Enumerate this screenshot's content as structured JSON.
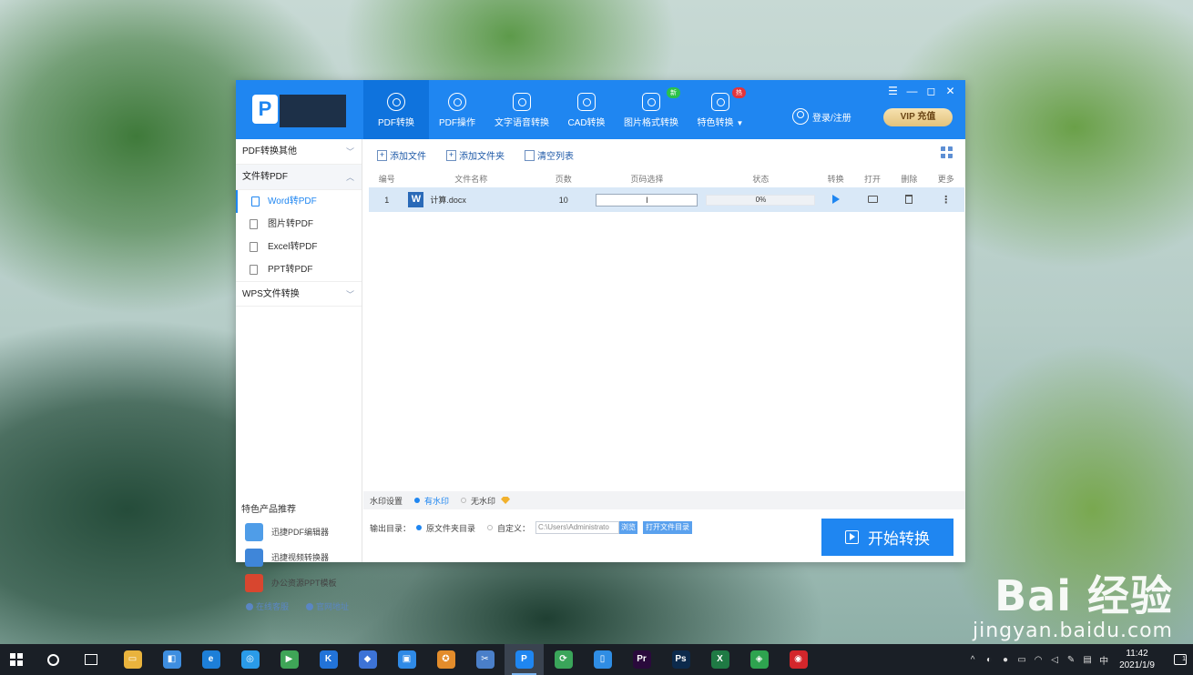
{
  "app": {
    "logo_letter": "P",
    "nav": [
      {
        "label": "PDF转换"
      },
      {
        "label": "PDF操作"
      },
      {
        "label": "文字语音转换"
      },
      {
        "label": "CAD转换"
      },
      {
        "label": "图片格式转换",
        "badge": "新"
      },
      {
        "label": "特色转换",
        "badge": "热"
      }
    ],
    "login_label": "登录/注册",
    "vip_label": "VIP 充值",
    "window_controls": {
      "menu": "☰",
      "minimize": "—",
      "maximize": "◻",
      "close": "✕"
    }
  },
  "sidebar": {
    "sections": [
      {
        "label": "PDF转换其他",
        "chevron": "﹀"
      },
      {
        "label": "文件转PDF",
        "chevron": "︿"
      },
      {
        "label": "WPS文件转换",
        "chevron": "﹀"
      }
    ],
    "items": [
      {
        "label": "Word转PDF"
      },
      {
        "label": "图片转PDF"
      },
      {
        "label": "Excel转PDF"
      },
      {
        "label": "PPT转PDF"
      }
    ],
    "promo_title": "特色产品推荐",
    "promos": [
      {
        "label": "迅捷PDF编辑器",
        "color": "#4f9de8"
      },
      {
        "label": "迅捷视频转换器",
        "color": "#3f86d9"
      },
      {
        "label": "办公资源PPT模板",
        "color": "#d8462f"
      }
    ],
    "footer": {
      "service": "在线客服",
      "website": "官网地址"
    }
  },
  "toolbar": {
    "add_file": "添加文件",
    "add_folder": "添加文件夹",
    "clear_list": "清空列表"
  },
  "table": {
    "headers": [
      "编号",
      "文件名称",
      "页数",
      "页码选择",
      "状态",
      "转换",
      "打开",
      "删除",
      "更多"
    ],
    "rows": [
      {
        "num": "1",
        "name": "计算.docx",
        "pages": "10",
        "range": "I",
        "progress": 0,
        "status": "0%"
      }
    ]
  },
  "watermark_bar": {
    "label": "水印设置",
    "with": "有水印",
    "without": "无水印"
  },
  "output": {
    "label": "输出目录：",
    "original": "原文件夹目录",
    "custom": "自定义：",
    "path": "C:\\Users\\Administrato",
    "browse": "浏览",
    "open_dir": "打开文件目录"
  },
  "start_label": "开始转换",
  "taskbar": {
    "apps": [
      {
        "name": "file-explorer",
        "glyph": "▭",
        "color": "#e9b33d"
      },
      {
        "name": "store",
        "glyph": "◧",
        "color": "#3e8ee0"
      },
      {
        "name": "edge",
        "glyph": "e",
        "color": "#1d7fd8"
      },
      {
        "name": "browser",
        "glyph": "◎",
        "color": "#2a9be8"
      },
      {
        "name": "video",
        "glyph": "▶",
        "color": "#3fa557"
      },
      {
        "name": "kugou",
        "glyph": "K",
        "color": "#2273d8"
      },
      {
        "name": "feishu",
        "glyph": "◆",
        "color": "#3d73d6"
      },
      {
        "name": "screen",
        "glyph": "▣",
        "color": "#2f8ae6"
      },
      {
        "name": "game",
        "glyph": "✪",
        "color": "#e38c2b"
      },
      {
        "name": "capture",
        "glyph": "✂",
        "color": "#4a7fc9"
      },
      {
        "name": "pdf-converter",
        "glyph": "P",
        "color": "#1f86f1"
      },
      {
        "name": "sync",
        "glyph": "⟳",
        "color": "#3aa55a"
      },
      {
        "name": "phone",
        "glyph": "▯",
        "color": "#2f8de4"
      },
      {
        "name": "premiere",
        "glyph": "Pr",
        "color": "#2a0a3c"
      },
      {
        "name": "photoshop",
        "glyph": "Ps",
        "color": "#0c2a4c"
      },
      {
        "name": "excel",
        "glyph": "X",
        "color": "#1f7a44"
      },
      {
        "name": "cube",
        "glyph": "◈",
        "color": "#2ea34f"
      },
      {
        "name": "netease-music",
        "glyph": "◉",
        "color": "#d3262b"
      }
    ],
    "tray": {
      "chevron": "^",
      "ime": "中",
      "time": "11:42",
      "date": "2021/1/9",
      "notif_count": "1"
    }
  },
  "wallpaper_watermark": {
    "logo": "Bai 经验",
    "url": "jingyan.baidu.com"
  }
}
